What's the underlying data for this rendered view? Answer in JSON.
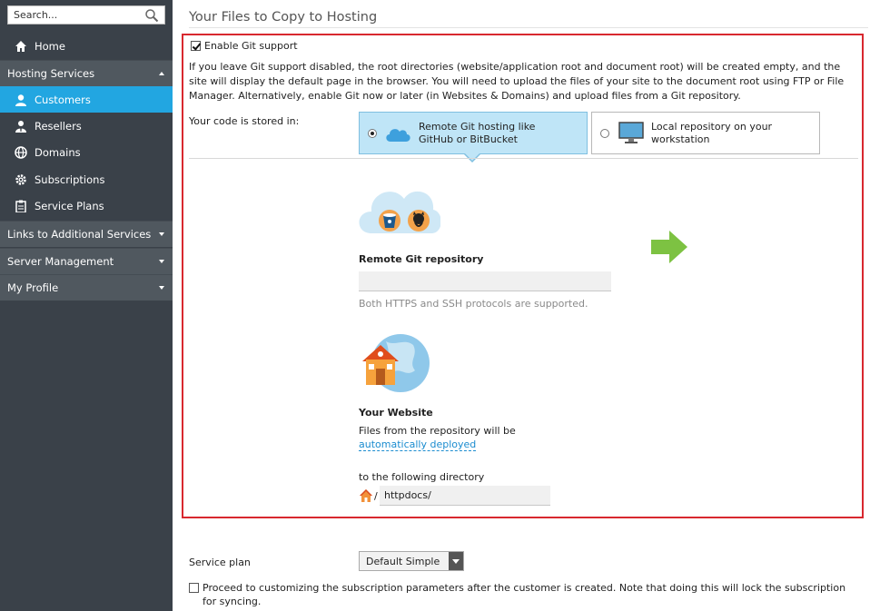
{
  "sidebar": {
    "search_placeholder": "Search...",
    "items": [
      {
        "label": "Home",
        "icon": "home-icon"
      },
      {
        "label": "Hosting Services",
        "section": true,
        "expanded": true
      },
      {
        "label": "Customers",
        "icon": "user-icon",
        "active": true
      },
      {
        "label": "Resellers",
        "icon": "reseller-icon"
      },
      {
        "label": "Domains",
        "icon": "globe-icon"
      },
      {
        "label": "Subscriptions",
        "icon": "gear-icon"
      },
      {
        "label": "Service Plans",
        "icon": "clipboard-icon"
      },
      {
        "label": "Links to Additional Services",
        "section": true
      },
      {
        "label": "Server Management",
        "section": true
      },
      {
        "label": "My Profile",
        "section": true
      }
    ]
  },
  "main": {
    "title": "Your Files to Copy to Hosting",
    "git": {
      "enable_label": "Enable Git support",
      "enabled": true,
      "info": "If you leave Git support disabled, the root directories (website/application root and document root) will be created empty, and the site will display the default page in the browser. You will need to upload the files of your site to the document root using FTP or File Manager. Alternatively, enable Git now or later (in Websites & Domains) and upload files from a Git repository.",
      "code_label": "Your code is stored in:",
      "choice_remote": "Remote Git hosting like GitHub or BitBucket",
      "choice_local": "Local repository on your workstation",
      "selected": "remote",
      "remote_heading": "Remote Git repository",
      "remote_url_value": "",
      "remote_hint": "Both HTTPS and SSH protocols are supported.",
      "website_heading": "Your Website",
      "website_desc": "Files from the repository will be",
      "deploy_link": "automatically deployed",
      "dir_label": "to the following directory",
      "dir_slash": "/",
      "dir_value": "httpdocs/"
    },
    "plan": {
      "label": "Service plan",
      "value": "Default Simple"
    },
    "customize_label": "Proceed to customizing the subscription parameters after the customer is created. Note that doing this will lock the subscription for syncing."
  },
  "colors": {
    "sidebar_bg": "#3a4149",
    "active": "#22a6e1",
    "frame": "#d8282f",
    "link": "#1b8ccf",
    "arrow": "#7dc242"
  }
}
